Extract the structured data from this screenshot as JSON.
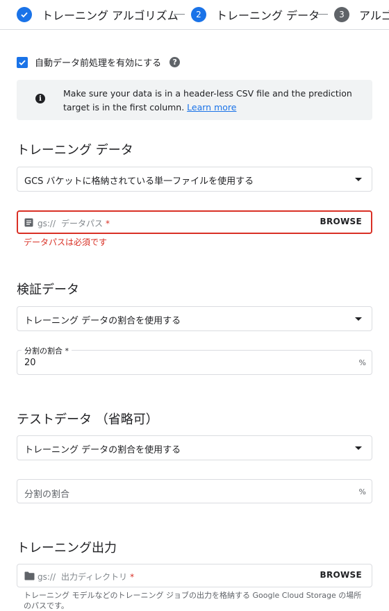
{
  "stepper": {
    "steps": [
      {
        "label": "トレーニング アルゴリズム",
        "state": "done"
      },
      {
        "label": "トレーニング データ",
        "number": "2",
        "state": "active"
      },
      {
        "label": "アルゴリズム",
        "number": "3",
        "state": "pending"
      }
    ]
  },
  "preprocessing": {
    "checkbox_label": "自動データ前処理を有効にする",
    "checked": true,
    "help_icon": "?"
  },
  "info": {
    "icon": "i",
    "text": "Make sure your data is in a header-less CSV file and the prediction target is in the first column.",
    "link_label": "Learn more"
  },
  "training_data": {
    "title": "トレーニング データ",
    "source_select": "GCS バケットに格納されている単一ファイルを使用する",
    "path": {
      "prefix": "gs://",
      "placeholder": "データパス",
      "required_mark": "*",
      "browse_label": "BROWSE",
      "error": "データパスは必須です"
    }
  },
  "validation_data": {
    "title": "検証データ",
    "select": "トレーニング データの割合を使用する",
    "split": {
      "label": "分割の割合",
      "required_mark": "*",
      "value": "20",
      "unit": "%"
    }
  },
  "test_data": {
    "title": "テストデータ （省略可）",
    "select": "トレーニング データの割合を使用する",
    "split": {
      "placeholder": "分割の割合",
      "unit": "%"
    }
  },
  "training_output": {
    "title": "トレーニング出力",
    "path": {
      "prefix": "gs://",
      "placeholder": "出力ディレクトリ",
      "required_mark": "*",
      "browse_label": "BROWSE"
    },
    "hint": "トレーニング モデルなどのトレーニング ジョブの出力を格納する Google Cloud Storage の場所のパスです。"
  },
  "colors": {
    "accent": "#1a73e8",
    "error": "#d93025",
    "pending_step": "#5f6368",
    "info_bg": "#f1f3f4"
  }
}
